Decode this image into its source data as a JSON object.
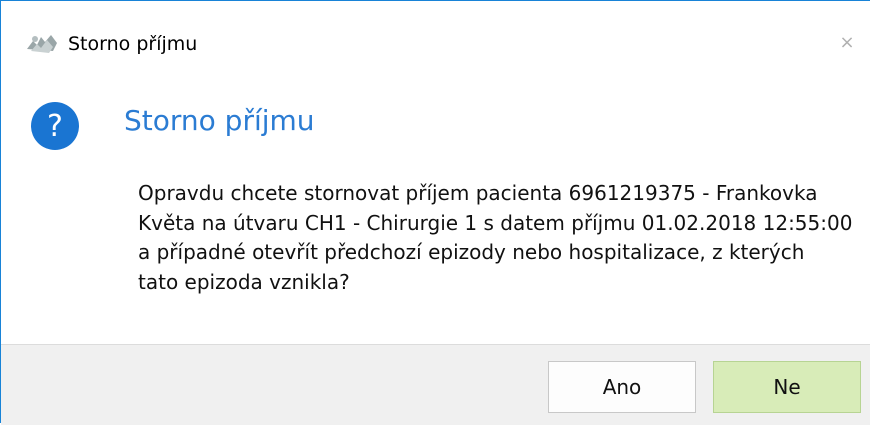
{
  "window": {
    "title": "Storno příjmu",
    "close_glyph": "×"
  },
  "dialog": {
    "icon": "question-icon",
    "heading": "Storno příjmu",
    "message_lines": [
      "Opravdu chcete stornovat příjem pacienta 6961219375 - Frankovka",
      "Květa na útvaru CH1 - Chirurgie 1 s datem příjmu 01.02.2018 12:55:00",
      "a případné otevřít předchozí epizody nebo hospitalizace, z kterých",
      "tato epizoda vznikla?"
    ]
  },
  "buttons": {
    "yes_label": "Ano",
    "no_label": "Ne"
  },
  "colors": {
    "accent": "#2b7cd3",
    "icon_blue": "#1a75d2",
    "default_button": "#d8ecb8",
    "window_border": "#1883d7"
  }
}
